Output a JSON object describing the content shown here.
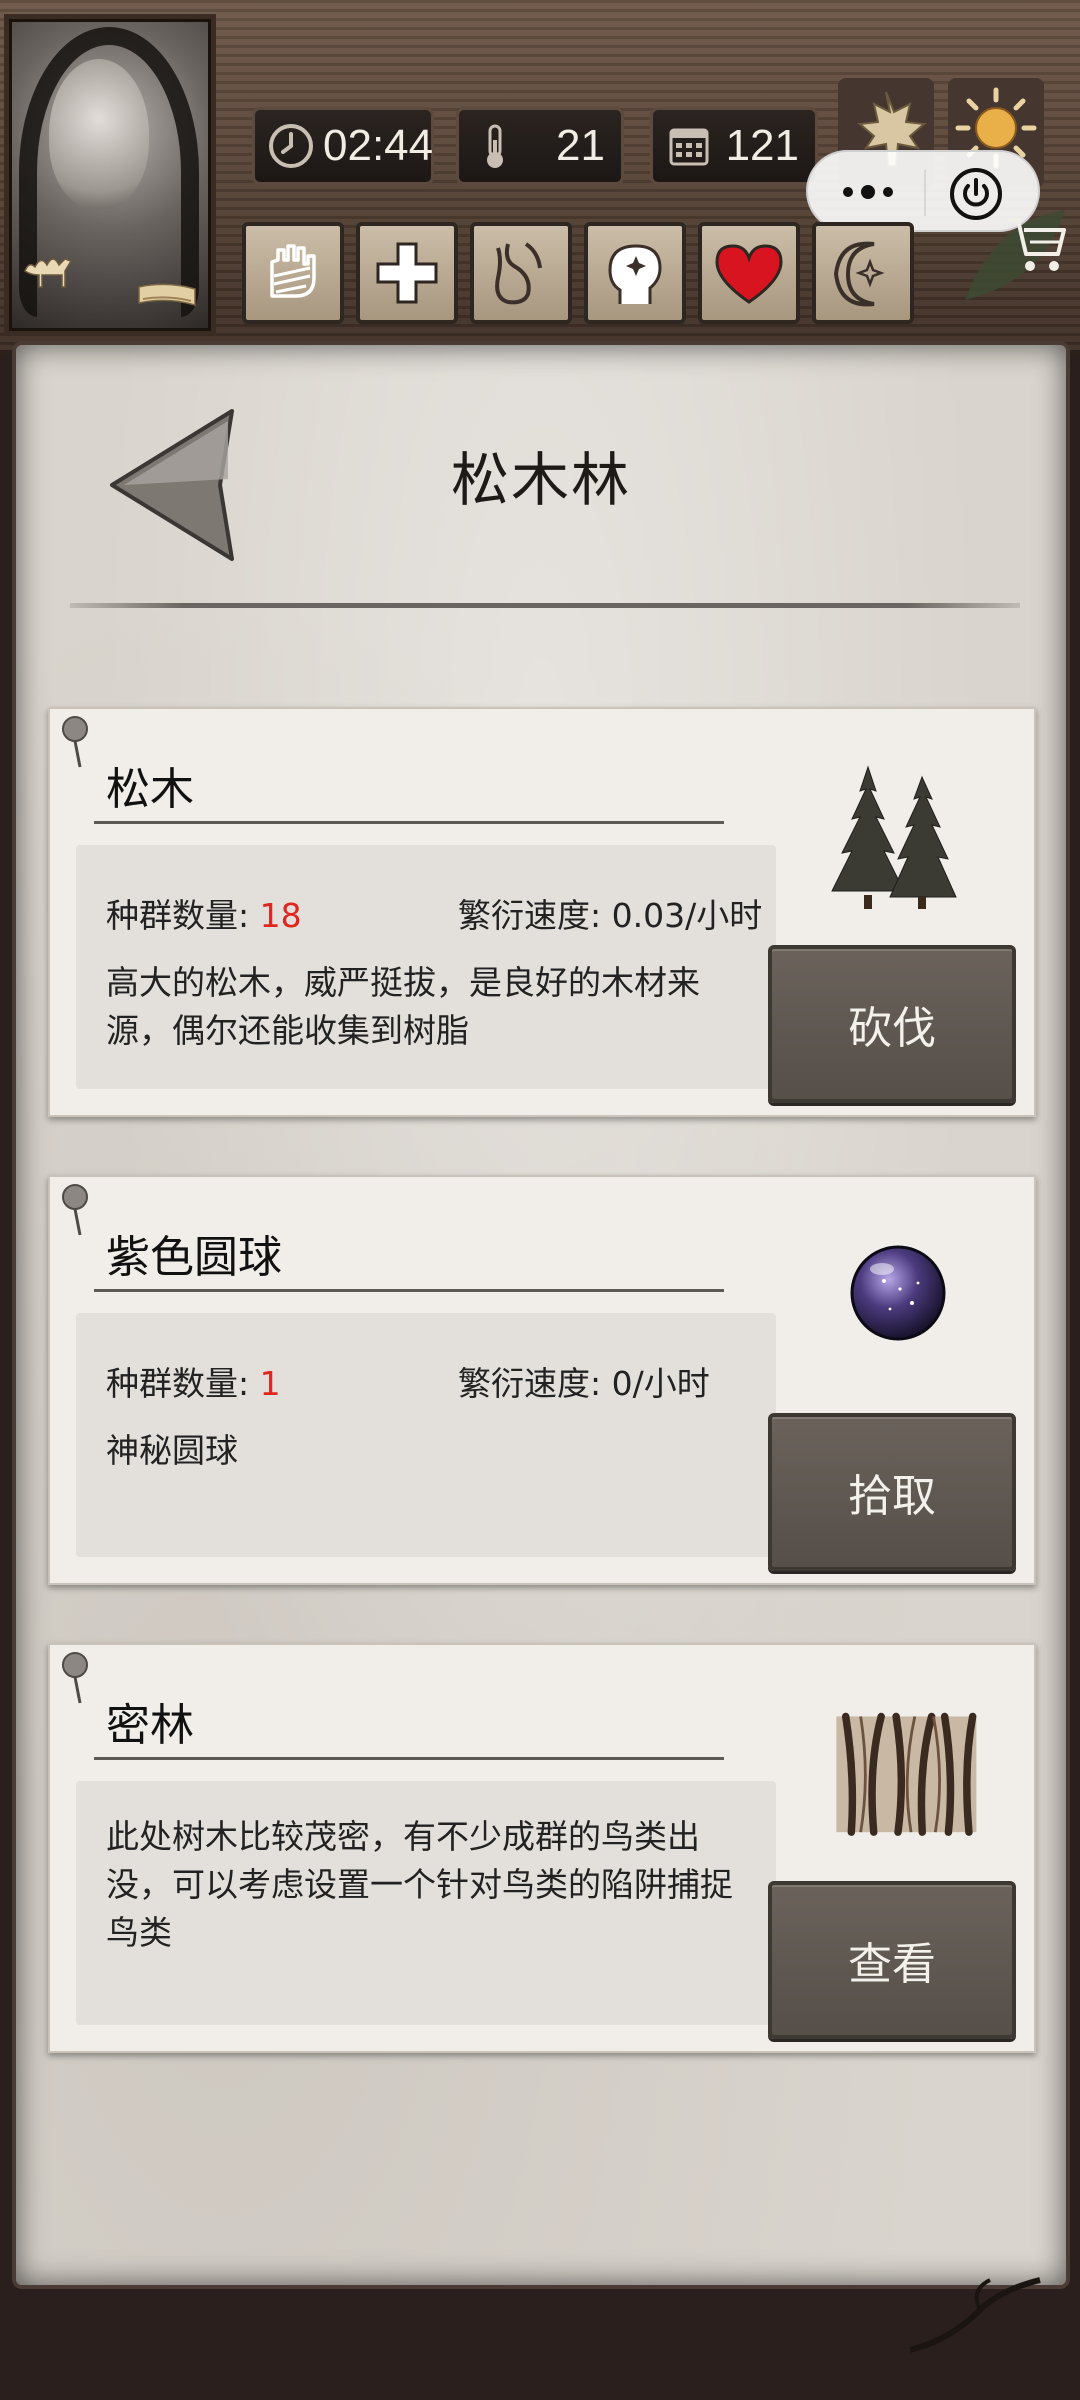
{
  "status_bar": {
    "time": "02:44",
    "temperature": "21",
    "day": "121"
  },
  "icons": {
    "portrait": "character-portrait",
    "camel": "camel-icon",
    "scroll": "scroll-icon",
    "clock": "clock-icon",
    "thermometer": "thermometer-icon",
    "calendar": "calendar-icon",
    "season": "maple-leaf-icon",
    "weather": "sun-icon",
    "cart": "shopping-cart-icon",
    "status_buttons": [
      "bandaged-hand-icon",
      "medical-cross-icon",
      "stomach-icon",
      "head-sparkle-icon",
      "heart-icon",
      "moon-star-icon"
    ]
  },
  "page": {
    "title": "松木林"
  },
  "cards": [
    {
      "name": "松木",
      "population_label": "种群数量: ",
      "population_value": "18",
      "rate_label": "繁衍速度: 0.03/小时",
      "description": "高大的松木，威严挺拔，是良好的木材来源，偶尔还能收集到树脂",
      "action": "砍伐"
    },
    {
      "name": "紫色圆球",
      "population_label": "种群数量: ",
      "population_value": "1",
      "rate_label": "繁衍速度: 0/小时",
      "description": "神秘圆球",
      "action": "拾取"
    },
    {
      "name": "密林",
      "description": "此处树木比较茂密，有不少成群的鸟类出没，可以考虑设置一个针对鸟类的陷阱捕捉鸟类",
      "action": "查看"
    }
  ],
  "colors": {
    "population_number": "#e0261f",
    "button_bg": "#5c554f",
    "parchment": "#d9d4cd"
  }
}
